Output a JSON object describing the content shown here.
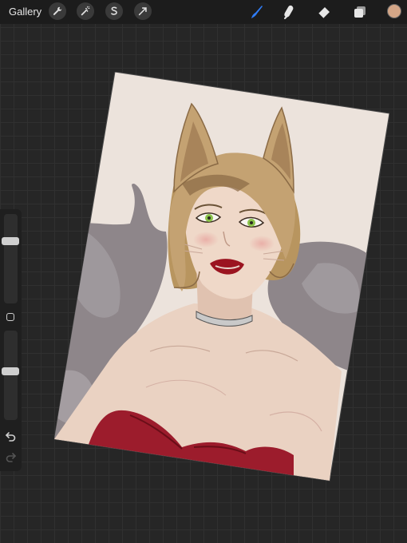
{
  "topbar": {
    "gallery_label": "Gallery",
    "actions_icons": [
      "wrench-icon",
      "magic-wand-icon",
      "selection-s-icon",
      "transform-arrow-icon"
    ],
    "tools_icons": [
      "brush-icon",
      "smudge-icon",
      "eraser-icon",
      "layers-icon"
    ],
    "active_tool": "brush-icon",
    "accent_color": "#2f7cf6",
    "current_color": "#d4a687"
  },
  "sidebar": {
    "brush_size_level": 0.28,
    "opacity_level": 0.45,
    "icons": [
      "modify-square-icon",
      "undo-icon",
      "redo-icon"
    ]
  },
  "canvas": {
    "palette": {
      "paper": "#ece3dc",
      "fur": "#8e868a",
      "hair": "#c4a272",
      "skin": "#ead2c2",
      "dress": "#9c1c2c",
      "eyes": "#8bc34a"
    }
  }
}
